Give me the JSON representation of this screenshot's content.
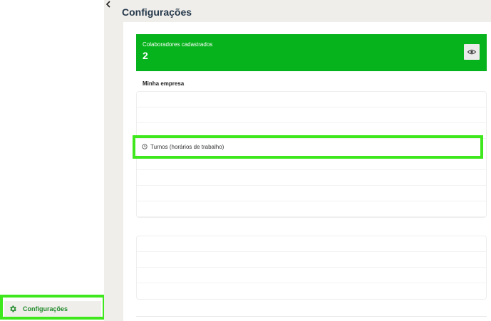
{
  "page": {
    "title": "Configurações"
  },
  "sidebar": {
    "items": [
      {
        "label": "Configurações",
        "icon": "gear-icon",
        "active": true
      }
    ]
  },
  "stats": {
    "collaborators_label": "Colaboradores cadastrados",
    "collaborators_value": "2",
    "view_icon": "eye-icon"
  },
  "company": {
    "title": "Minha empresa",
    "items": [
      {
        "label": "Turnos (horários de trabalho)",
        "icon": "clock-icon"
      }
    ]
  },
  "colors": {
    "accent": "#07b31c",
    "highlight": "#3ee81d",
    "sidebar_text": "#1f8a2a",
    "title_text": "#24384a"
  }
}
